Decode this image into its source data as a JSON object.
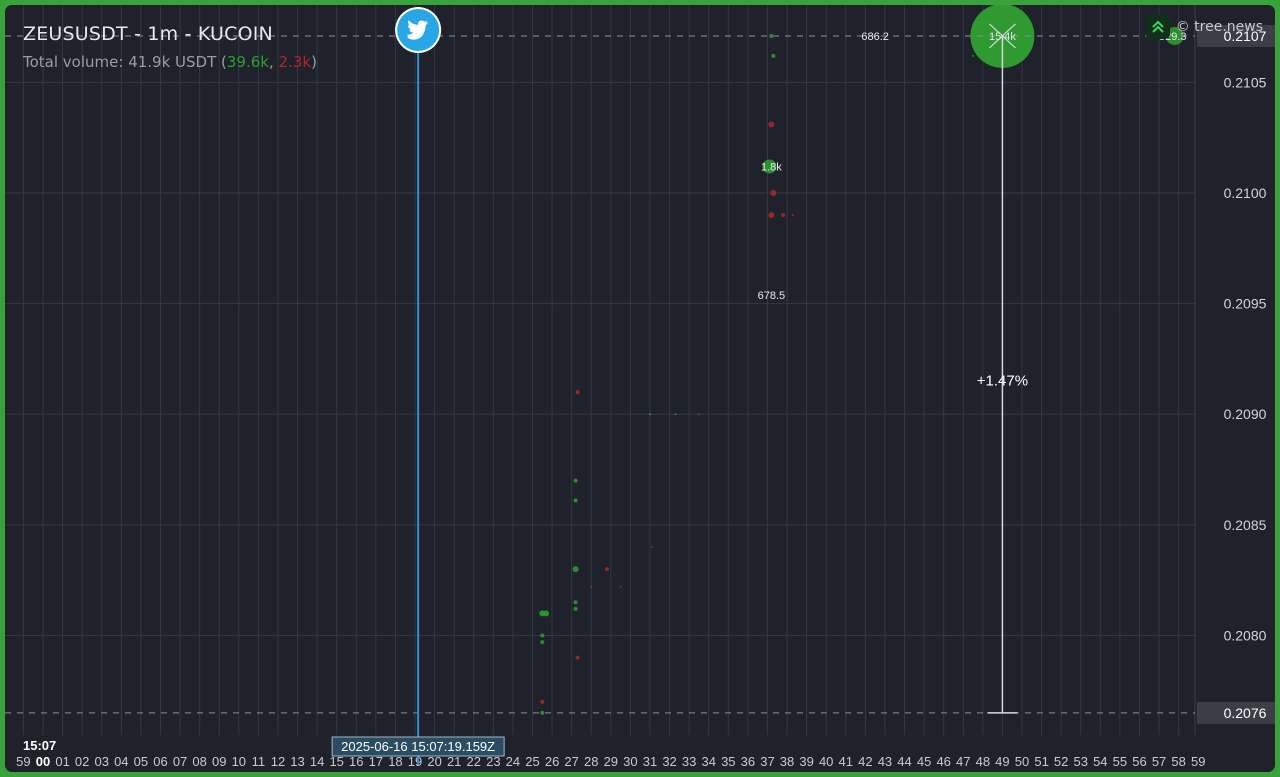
{
  "header": {
    "title": "ZEUSUSDT - 1m - KUCOIN",
    "volume_prefix": "Total volume: 41.9k USDT (",
    "volume_buy": "39.6k",
    "volume_sep": ", ",
    "volume_sell": "2.3k",
    "volume_suffix": ")"
  },
  "brand": {
    "text": "© tree.news",
    "icon": "tree-news-logo-icon"
  },
  "colors": {
    "background": "#1f222b",
    "frame": "#3aa23a",
    "buy": "#2fa12f",
    "sell": "#b2262b",
    "event_line": "#2e8ed6",
    "grid": "#333845"
  },
  "time_axis": {
    "hour_label": "15:07",
    "minute_ticks": [
      "59",
      "00",
      "01",
      "02",
      "03",
      "04",
      "05",
      "06",
      "07",
      "08",
      "09",
      "10",
      "11",
      "12",
      "13",
      "14",
      "15",
      "16",
      "17",
      "18",
      "19",
      "20",
      "21",
      "22",
      "23",
      "24",
      "25",
      "26",
      "27",
      "28",
      "29",
      "30",
      "31",
      "32",
      "33",
      "34",
      "35",
      "36",
      "37",
      "38",
      "39",
      "40",
      "41",
      "42",
      "43",
      "44",
      "45",
      "46",
      "47",
      "48",
      "49",
      "50",
      "51",
      "52",
      "53",
      "54",
      "55",
      "56",
      "57",
      "58",
      "59"
    ],
    "event_label": "2025-06-16 15:07:19.159Z"
  },
  "event": {
    "type": "twitter",
    "icon": "twitter-bird-icon",
    "second": 19.159
  },
  "chart_data": {
    "type": "scatter",
    "title": "ZEUSUSDT - 1m - KUCOIN",
    "xlabel": "",
    "ylabel": "",
    "x_unit": "seconds after 15:07",
    "ylim": [
      0.20755,
      0.21085
    ],
    "y_ticks": [
      "0.2080",
      "0.2085",
      "0.2090",
      "0.2095",
      "0.2100",
      "0.2105"
    ],
    "y_tick_values": [
      0.208,
      0.2085,
      0.209,
      0.2095,
      0.21,
      0.2105
    ],
    "price_markers": [
      {
        "label": "0.2107",
        "value": 0.21071
      },
      {
        "label": "0.2076",
        "value": 0.20765
      }
    ],
    "change_measure": {
      "label": "+1.47%",
      "second": 49.0,
      "from": 0.20765,
      "to": 0.21071
    },
    "trade_labels": [
      {
        "text": "1.8k",
        "second": 37.2,
        "price": 0.21012
      },
      {
        "text": "678.5",
        "second": 37.2,
        "price": 0.20954
      },
      {
        "text": "15.4k",
        "second": 49.0,
        "price": 0.21071
      },
      {
        "text": "686.2",
        "second": 42.5,
        "price": 0.21071
      },
      {
        "text": "529.3",
        "second": 57.7,
        "price": 0.21071
      }
    ],
    "series": [
      {
        "name": "buy",
        "points": [
          [
            25.5,
            0.20765
          ],
          [
            25.5,
            0.2081
          ],
          [
            25.7,
            0.2081
          ],
          [
            25.5,
            0.208
          ],
          [
            25.5,
            0.20797
          ],
          [
            27.2,
            0.2087
          ],
          [
            27.2,
            0.20861
          ],
          [
            27.2,
            0.2083
          ],
          [
            27.2,
            0.20815
          ],
          [
            27.2,
            0.20812
          ],
          [
            31.0,
            0.209
          ],
          [
            32.3,
            0.209
          ],
          [
            37.2,
            0.21071
          ],
          [
            37.3,
            0.21062
          ],
          [
            37.1,
            0.21012
          ],
          [
            47.5,
            0.21062
          ],
          [
            49.0,
            0.21071
          ],
          [
            57.8,
            0.21071
          ]
        ],
        "sizes": [
          2,
          3,
          3,
          2,
          2,
          2,
          2,
          3,
          2,
          2,
          1,
          1,
          2,
          2,
          7,
          1,
          32,
          9
        ]
      },
      {
        "name": "sell",
        "points": [
          [
            25.5,
            0.2077
          ],
          [
            27.3,
            0.2091
          ],
          [
            27.3,
            0.2079
          ],
          [
            28.0,
            0.20822
          ],
          [
            28.8,
            0.2083
          ],
          [
            29.5,
            0.20822
          ],
          [
            31.1,
            0.2084
          ],
          [
            33.5,
            0.209
          ],
          [
            37.2,
            0.21031
          ],
          [
            37.3,
            0.21
          ],
          [
            37.2,
            0.2099
          ],
          [
            37.8,
            0.2099
          ],
          [
            38.3,
            0.2099
          ]
        ],
        "sizes": [
          2,
          2,
          2,
          1,
          2,
          1,
          1,
          1,
          3,
          3,
          3,
          2,
          1
        ]
      }
    ]
  }
}
